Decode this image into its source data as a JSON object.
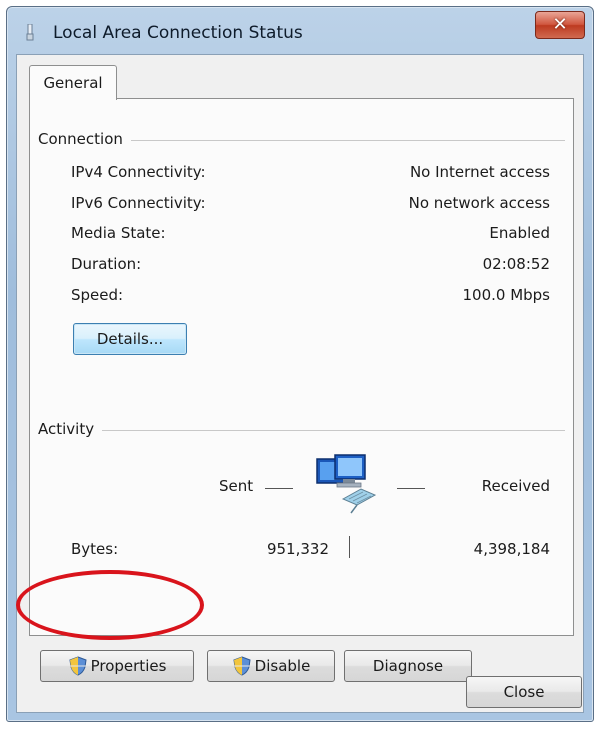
{
  "window": {
    "title": "Local Area Connection Status",
    "close_glyph": "✕"
  },
  "tabs": [
    {
      "label": "General",
      "selected": true
    }
  ],
  "connection": {
    "heading": "Connection",
    "rows": [
      {
        "label": "IPv4 Connectivity:",
        "value": "No Internet access"
      },
      {
        "label": "IPv6 Connectivity:",
        "value": "No network access"
      },
      {
        "label": "Media State:",
        "value": "Enabled"
      },
      {
        "label": "Duration:",
        "value": "02:08:52"
      },
      {
        "label": "Speed:",
        "value": "100.0 Mbps"
      }
    ],
    "details_button": "Details..."
  },
  "activity": {
    "heading": "Activity",
    "sent_label": "Sent",
    "received_label": "Received",
    "bytes_label": "Bytes:",
    "bytes_sent": "951,332",
    "bytes_received": "4,398,184",
    "icon": "network-computers-icon"
  },
  "buttons": {
    "properties": "Properties",
    "disable": "Disable",
    "diagnose": "Diagnose",
    "close": "Close"
  },
  "colors": {
    "highlight_oval": "#d9141c",
    "focus_border": "#3c7fb1"
  }
}
